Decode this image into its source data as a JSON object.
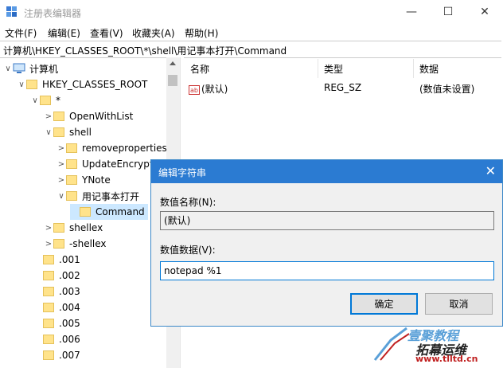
{
  "window": {
    "title": "注册表编辑器",
    "minimize": "—",
    "maximize": "☐",
    "close": "✕"
  },
  "menu": [
    "文件(F)",
    "编辑(E)",
    "查看(V)",
    "收藏夹(A)",
    "帮助(H)"
  ],
  "address": "计算机\\HKEY_CLASSES_ROOT\\*\\shell\\用记事本打开\\Command",
  "tree": [
    {
      "label": "计算机",
      "arrow": "∨",
      "icon": "computer-icon"
    },
    {
      "label": "HKEY_CLASSES_ROOT",
      "arrow": "∨",
      "icon": "folder-icon"
    },
    {
      "label": "*",
      "arrow": "∨",
      "icon": "folder-icon"
    },
    {
      "label": "OpenWithList",
      "arrow": ">",
      "icon": "folder-icon"
    },
    {
      "label": "shell",
      "arrow": "∨",
      "icon": "folder-icon"
    },
    {
      "label": "removeproperties",
      "arrow": ">",
      "icon": "folder-icon"
    },
    {
      "label": "UpdateEncryptionSettings",
      "arrow": ">",
      "icon": "folder-icon"
    },
    {
      "label": "YNote",
      "arrow": ">",
      "icon": "folder-icon"
    },
    {
      "label": "用记事本打开",
      "arrow": "∨",
      "icon": "folder-icon"
    },
    {
      "label": "Command",
      "arrow": "",
      "icon": "folder-icon",
      "selected": true
    },
    {
      "label": "shellex",
      "arrow": ">",
      "icon": "folder-icon"
    },
    {
      "label": "-shellex",
      "arrow": ">",
      "icon": "folder-icon"
    },
    {
      "label": ".001",
      "arrow": "",
      "icon": "folder-icon"
    },
    {
      "label": ".002",
      "arrow": "",
      "icon": "folder-icon"
    },
    {
      "label": ".003",
      "arrow": "",
      "icon": "folder-icon"
    },
    {
      "label": ".004",
      "arrow": "",
      "icon": "folder-icon"
    },
    {
      "label": ".005",
      "arrow": "",
      "icon": "folder-icon"
    },
    {
      "label": ".006",
      "arrow": "",
      "icon": "folder-icon"
    },
    {
      "label": ".007",
      "arrow": "",
      "icon": "folder-icon"
    }
  ],
  "list": {
    "headers": [
      "名称",
      "类型",
      "数据"
    ],
    "rows": [
      {
        "icon_text": "ab",
        "name": "(默认)",
        "type": "REG_SZ",
        "data": "(数值未设置)"
      }
    ]
  },
  "dialog": {
    "title": "编辑字符串",
    "close": "✕",
    "name_label": "数值名称(N):",
    "name_value": "(默认)",
    "data_label": "数值数据(V):",
    "data_value": "notepad %1",
    "ok": "确定",
    "cancel": "取消"
  },
  "watermark": {
    "line1": "壹聚教程",
    "line2": "拓幕运维",
    "url": "www.tlltd.cn"
  }
}
